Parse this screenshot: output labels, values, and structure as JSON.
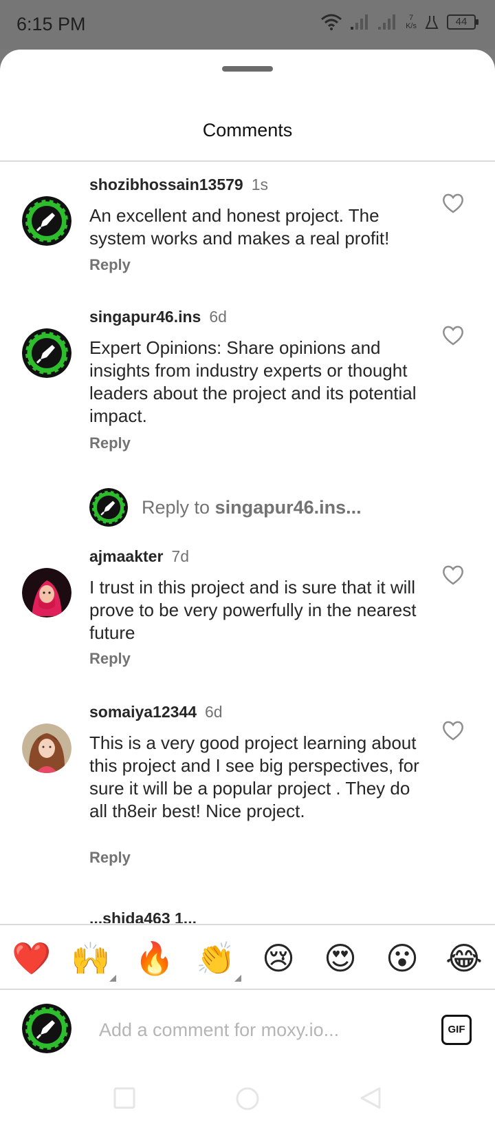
{
  "status": {
    "time": "6:15 PM",
    "net_speed_value": "7",
    "net_speed_unit": "K/s",
    "battery": "44"
  },
  "sheet": {
    "title": "Comments"
  },
  "comments": [
    {
      "username": "shozibhossain13579",
      "time": "1s",
      "text": "An excellent and honest project. The system works and makes a real profit!",
      "reply_label": "Reply",
      "avatar": "rocket-logo-icon"
    },
    {
      "username": "singapur46.ins",
      "time": "6d",
      "text": "Expert Opinions: Share opinions and insights from industry experts or thought leaders about the project and its potential impact.",
      "reply_label": "Reply",
      "avatar": "rocket-logo-icon"
    },
    {
      "username": "ajmaakter",
      "time": "7d",
      "text": "I trust in this project and is sure that it will prove to be very powerfully in the nearest future",
      "reply_label": "Reply",
      "avatar": "user-photo"
    },
    {
      "username": "somaiya12344",
      "time": "6d",
      "text": "This is a very good project learning about this project and I see big perspectives, for sure it will be a popular project . They do all th8eir best! Nice project.",
      "reply_label": "Reply",
      "avatar": "user-photo"
    }
  ],
  "reply_to": {
    "prefix": "Reply to",
    "target": "singapur46.ins..."
  },
  "peek_text": "...shida463 1...",
  "emojis": [
    "❤️",
    "🙌",
    "🔥",
    "👏",
    "😢",
    "😍",
    "😮",
    "😂"
  ],
  "composer": {
    "placeholder": "Add a comment for moxy.io...",
    "gif_label": "GIF"
  },
  "navbar": {
    "buttons": [
      "recent-apps-icon",
      "home-icon",
      "back-icon"
    ]
  },
  "colors": {
    "logo_green": "#2dbd2d",
    "logo_black": "#111111",
    "muted_text": "#737373"
  }
}
